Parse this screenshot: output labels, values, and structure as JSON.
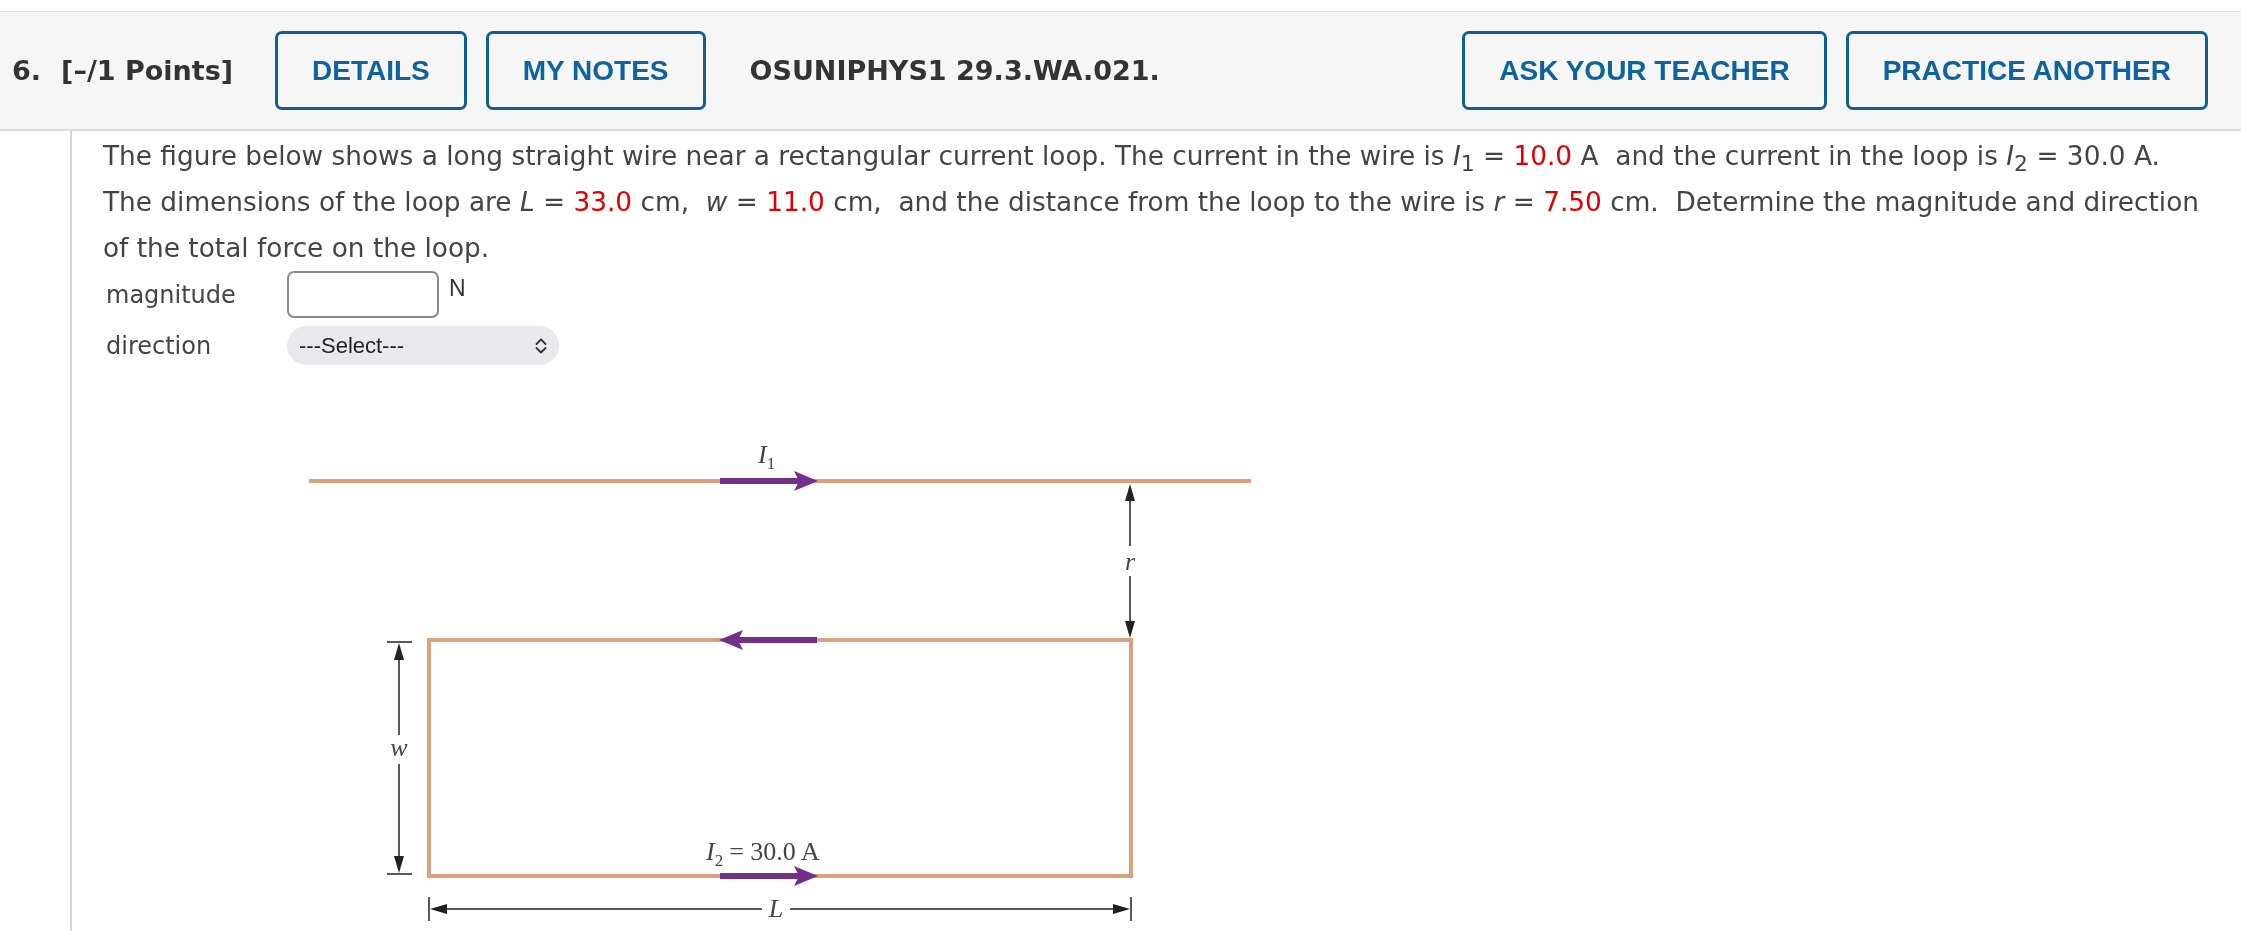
{
  "header": {
    "number": "6.",
    "points": "[–/1 Points]",
    "left_buttons": [
      {
        "label": "DETAILS"
      },
      {
        "label": "MY NOTES"
      }
    ],
    "code": "OSUNIPHYS1 29.3.WA.021.",
    "right_buttons": [
      {
        "label": "ASK YOUR TEACHER"
      },
      {
        "label": "PRACTICE ANOTHER"
      }
    ]
  },
  "problem": {
    "segments": [
      {
        "kind": "text",
        "text": "The figure below shows a long straight wire near a rectangular current loop. The current in the wire is *I*$_{1}$ = "
      },
      {
        "kind": "given",
        "text": "10.0"
      },
      {
        "kind": "text",
        "text": " A  and the current in the loop is *I*$_{2}$ = 30.0 A. The dimensions of the loop are *L* = "
      },
      {
        "kind": "given",
        "text": "33.0"
      },
      {
        "kind": "text",
        "text": " cm,  *w* = "
      },
      {
        "kind": "given",
        "text": "11.0"
      },
      {
        "kind": "text",
        "text": " cm,  and the distance from the loop to the wire is *r* = "
      },
      {
        "kind": "given",
        "text": "7.50"
      },
      {
        "kind": "text",
        "text": " cm.  Determine the magnitude and direction of the total force on the loop."
      }
    ]
  },
  "answers": [
    {
      "kind": "number",
      "label": "magnitude",
      "unit": "N"
    },
    {
      "kind": "select",
      "label": "direction",
      "value": "---Select---"
    }
  ],
  "figure": {
    "wire_label": {
      "symbol": "I",
      "subscript": "1"
    },
    "distance_label": "r",
    "width_label": "w",
    "loop_label": {
      "symbol": "I",
      "subscript": "2",
      "rest": "= 30.0 A"
    },
    "length_label": "L"
  }
}
